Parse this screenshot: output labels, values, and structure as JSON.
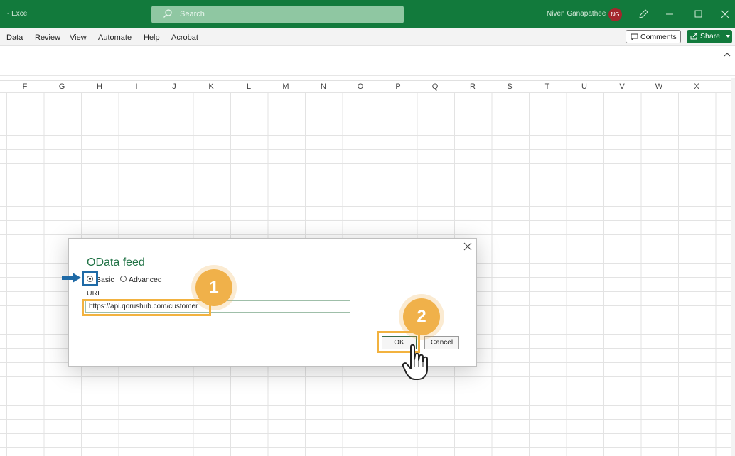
{
  "titlebar": {
    "app_name": "- Excel",
    "search_placeholder": "Search",
    "user_name": "Niven Ganapathee",
    "user_initials": "NG",
    "accent": "#127a3c"
  },
  "menu": {
    "items": [
      "Data",
      "Review",
      "View",
      "Automate",
      "Help",
      "Acrobat"
    ],
    "comments_label": "Comments",
    "share_label": "Share"
  },
  "columns": [
    "F",
    "G",
    "H",
    "I",
    "J",
    "K",
    "L",
    "M",
    "N",
    "O",
    "P",
    "Q",
    "R",
    "S",
    "T",
    "U",
    "V",
    "W",
    "X"
  ],
  "dialog": {
    "title": "OData feed",
    "radio_basic": "Basic",
    "radio_advanced": "Advanced",
    "selected": "Basic",
    "url_label": "URL",
    "url_value": "https://api.qorushub.com/customer",
    "ok_label": "OK",
    "cancel_label": "Cancel"
  },
  "callouts": {
    "step1": "1",
    "step2": "2",
    "highlight_color": "#f2b23f",
    "arrow_color": "#1f6aa6"
  }
}
